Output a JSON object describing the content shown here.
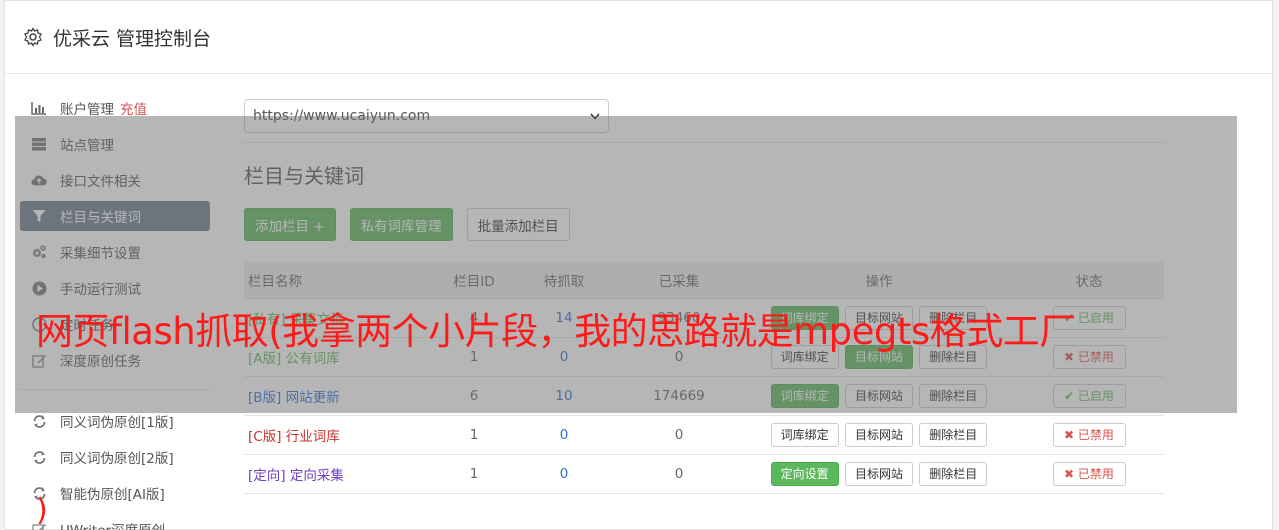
{
  "header": {
    "title": "优采云 管理控制台",
    "icon": "gear-icon"
  },
  "sidebar": {
    "items": [
      {
        "label": "账户管理",
        "extra": "充值",
        "icon": "bar-chart-icon"
      },
      {
        "label": "站点管理",
        "icon": "server-icon"
      },
      {
        "label": "接口文件相关",
        "icon": "cloud-upload-icon"
      },
      {
        "label": "栏目与关键词",
        "icon": "filter-icon",
        "active": true
      },
      {
        "label": "采集细节设置",
        "icon": "cogs-icon"
      },
      {
        "label": "手动运行测试",
        "icon": "play-icon"
      },
      {
        "label": "定时任务",
        "icon": "clock-icon"
      },
      {
        "label": "深度原创任务",
        "icon": "edit-icon"
      }
    ],
    "items2": [
      {
        "label": "同义词伪原创[1版]",
        "icon": "refresh-icon"
      },
      {
        "label": "同义词伪原创[2版]",
        "icon": "refresh-icon"
      },
      {
        "label": "智能伪原创[AI版]",
        "icon": "refresh-icon"
      },
      {
        "label": "UWriter深度原创",
        "icon": "edit-icon"
      }
    ]
  },
  "main": {
    "site_select": "https://www.ucaiyun.com",
    "section_title": "栏目与关键词",
    "buttons": {
      "add": "添加栏目 +",
      "private": "私有词库管理",
      "batch": "批量添加栏目"
    },
    "table": {
      "headers": [
        "栏目名称",
        "栏目ID",
        "待抓取",
        "已采集",
        "操作",
        "状态"
      ],
      "rows": [
        {
          "tag": "[私有]",
          "name": "采集文稿",
          "id": "4",
          "pending": "14",
          "collected": "93460",
          "btn1": "词库绑定",
          "btn2": "目标网站",
          "btn3": "删除栏目",
          "status": "已启用"
        },
        {
          "tag": "[A版]",
          "name": "公有词库",
          "id": "1",
          "pending": "0",
          "collected": "0",
          "btn1": "词库绑定",
          "btn2": "目标网站",
          "btn3": "删除栏目",
          "status": "已禁用"
        },
        {
          "tag": "[B版]",
          "name": "网站更新",
          "id": "6",
          "pending": "10",
          "collected": "174669",
          "btn1": "词库绑定",
          "btn2": "目标网站",
          "btn3": "删除栏目",
          "status": "已启用"
        },
        {
          "tag": "[C版]",
          "name": "行业词库",
          "id": "1",
          "pending": "0",
          "collected": "0",
          "btn1": "词库绑定",
          "btn2": "目标网站",
          "btn3": "删除栏目",
          "status": "已禁用"
        },
        {
          "tag": "[定向]",
          "name": "定向采集",
          "id": "1",
          "pending": "0",
          "collected": "0",
          "btn1": "定向设置",
          "btn2": "目标网站",
          "btn3": "删除栏目",
          "status": "已禁用"
        }
      ]
    }
  },
  "overlay": {
    "caption": "网页flash抓取(我拿两个小片段，我的思路就是mpegts格式工厂",
    "paren": ")"
  },
  "colors": {
    "accent_green": "#5cb85c",
    "active_sidebar": "#6b7a8f",
    "danger": "#d9534f",
    "caption_red": "#ff1a1a"
  }
}
